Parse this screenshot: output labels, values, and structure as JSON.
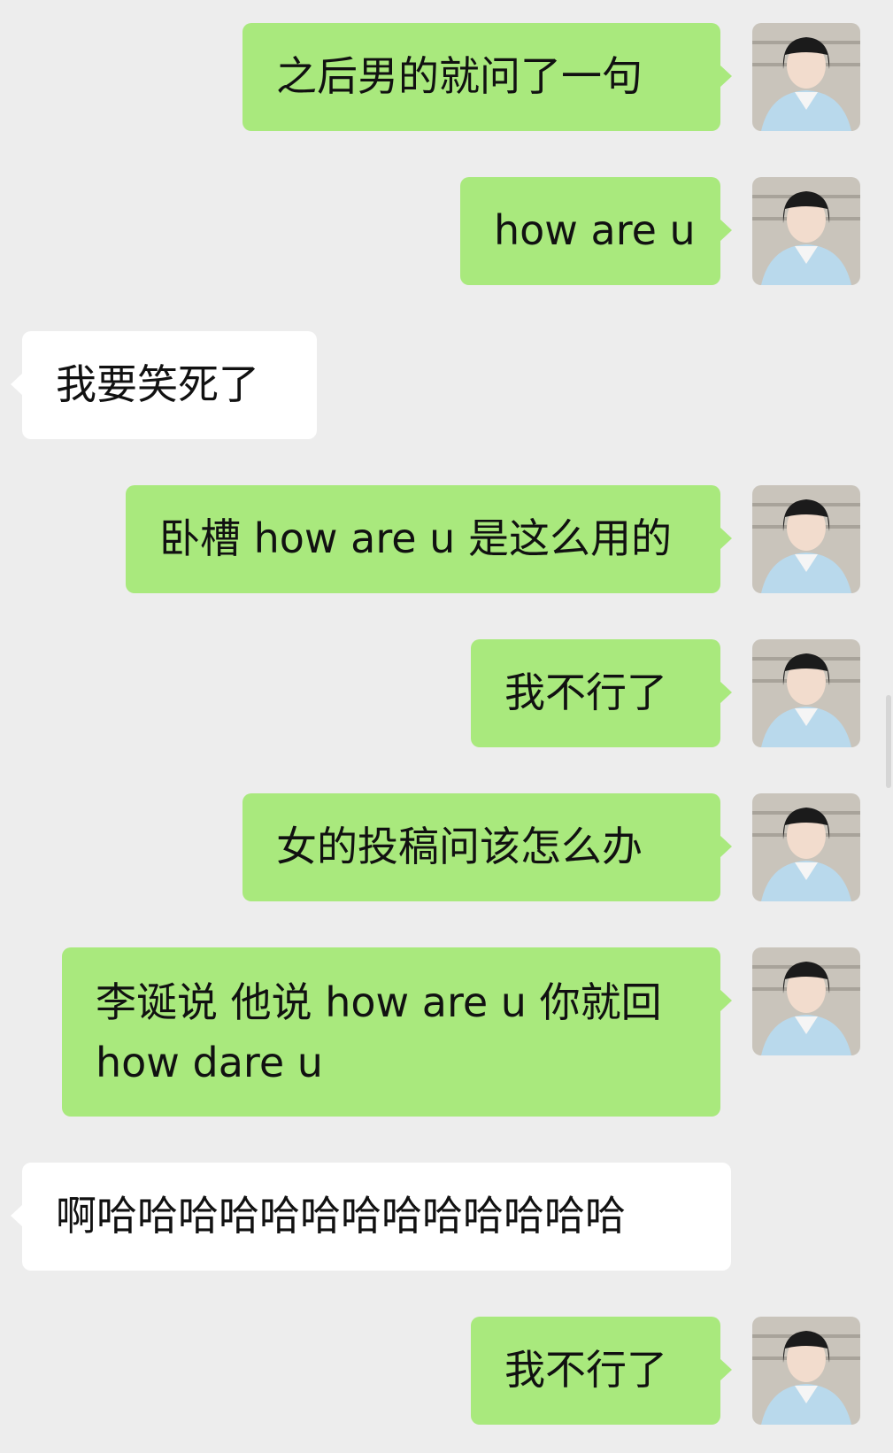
{
  "messages": [
    {
      "from": "me",
      "text": "之后男的就问了一句"
    },
    {
      "from": "me",
      "text": "how are u"
    },
    {
      "from": "them",
      "text": "我要笑死了"
    },
    {
      "from": "me",
      "text": "卧槽 how are u 是这么用的"
    },
    {
      "from": "me",
      "text": "我不行了"
    },
    {
      "from": "me",
      "text": "女的投稿问该怎么办"
    },
    {
      "from": "me",
      "line1": "李诞说 他说 how are u 你就回",
      "line2": "how dare u"
    },
    {
      "from": "them",
      "text": "啊哈哈哈哈哈哈哈哈哈哈哈哈哈"
    },
    {
      "from": "me",
      "text": "我不行了"
    }
  ],
  "avatar": {
    "name": "user-avatar",
    "colors": {
      "bg": "#c9c4bb",
      "hair": "#1b1b1b",
      "skin": "#f2dccd",
      "sweater": "#b9d9ec",
      "collar": "#f5f5f5"
    }
  },
  "colors": {
    "background": "#ededed",
    "my_bubble": "#a9e97d",
    "their_bubble": "#ffffff",
    "text": "#111111"
  }
}
